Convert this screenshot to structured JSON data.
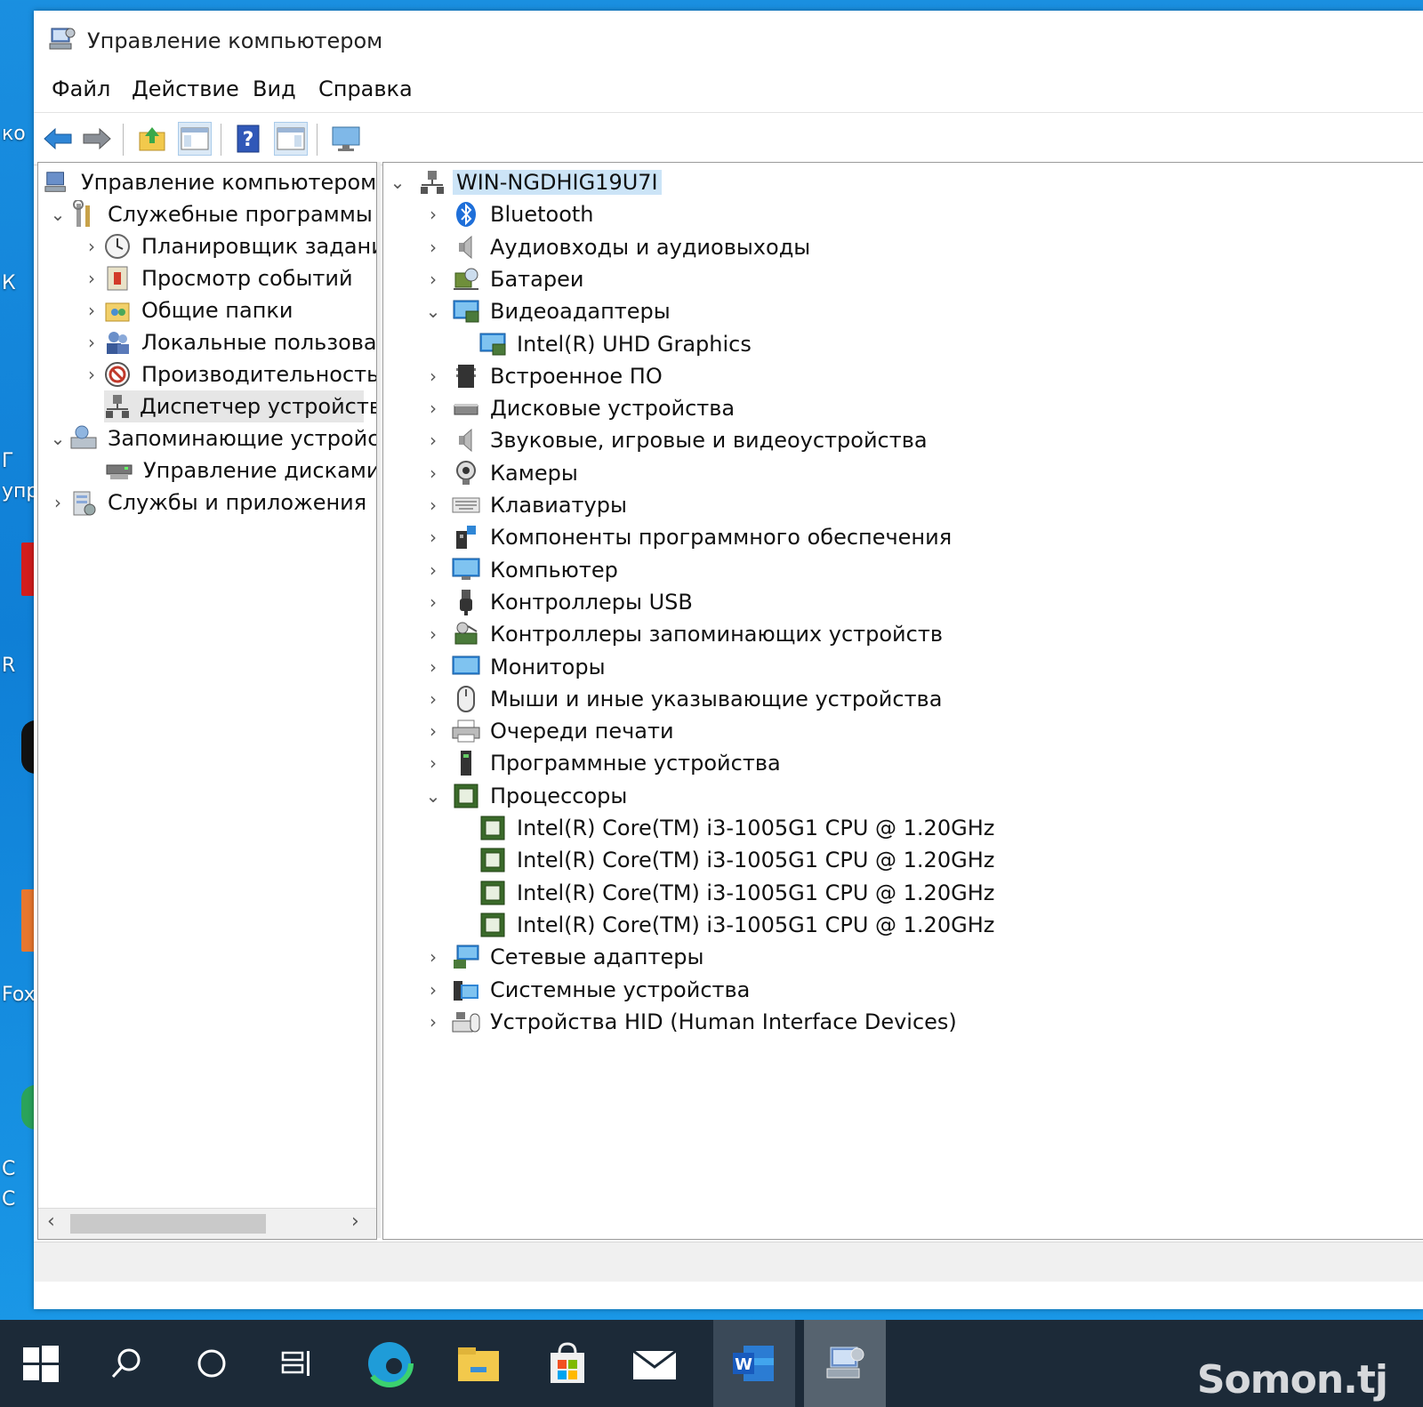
{
  "window": {
    "title": "Управление компьютером",
    "menu": [
      "Файл",
      "Действие",
      "Вид",
      "Справка"
    ]
  },
  "toolbar": {
    "buttons": [
      "back-arrow-icon",
      "forward-arrow-icon",
      "up-folder-icon",
      "show-hide-tree-icon",
      "help-icon",
      "action-pane-icon",
      "monitor-icon"
    ]
  },
  "left_tree": {
    "items": [
      {
        "label": "Управление компьютером (л",
        "icon": "computer-management-icon"
      },
      {
        "label": "Служебные программы",
        "icon": "tools-icon"
      },
      {
        "label": "Планировщик заданий",
        "icon": "clock-icon"
      },
      {
        "label": "Просмотр событий",
        "icon": "event-viewer-icon"
      },
      {
        "label": "Общие папки",
        "icon": "shared-folder-icon"
      },
      {
        "label": "Локальные пользовате",
        "icon": "users-icon"
      },
      {
        "label": "Производительность",
        "icon": "performance-icon"
      },
      {
        "label": "Диспетчер устройств",
        "icon": "device-manager-icon"
      },
      {
        "label": "Запоминающие устройст",
        "icon": "storage-icon"
      },
      {
        "label": "Управление дисками",
        "icon": "disk-management-icon"
      },
      {
        "label": "Службы и приложения",
        "icon": "services-icon"
      }
    ]
  },
  "device_tree": {
    "root": "WIN-NGDHIG19U7I",
    "items": [
      {
        "label": "Bluetooth",
        "icon": "bluetooth-icon"
      },
      {
        "label": "Аудиовходы и аудиовыходы",
        "icon": "speaker-icon"
      },
      {
        "label": "Батареи",
        "icon": "battery-icon"
      },
      {
        "label": "Видеоадаптеры",
        "icon": "display-adapter-icon"
      },
      {
        "label": "Intel(R) UHD Graphics",
        "icon": "display-adapter-icon"
      },
      {
        "label": "Встроенное ПО",
        "icon": "firmware-icon"
      },
      {
        "label": "Дисковые устройства",
        "icon": "disk-drive-icon"
      },
      {
        "label": "Звуковые, игровые и видеоустройства",
        "icon": "speaker-icon"
      },
      {
        "label": "Камеры",
        "icon": "camera-icon"
      },
      {
        "label": "Клавиатуры",
        "icon": "keyboard-icon"
      },
      {
        "label": "Компоненты программного обеспечения",
        "icon": "software-component-icon"
      },
      {
        "label": "Компьютер",
        "icon": "computer-icon"
      },
      {
        "label": "Контроллеры USB",
        "icon": "usb-icon"
      },
      {
        "label": "Контроллеры запоминающих устройств",
        "icon": "storage-controller-icon"
      },
      {
        "label": "Мониторы",
        "icon": "monitor-icon"
      },
      {
        "label": "Мыши и иные указывающие устройства",
        "icon": "mouse-icon"
      },
      {
        "label": "Очереди печати",
        "icon": "printer-icon"
      },
      {
        "label": "Программные устройства",
        "icon": "software-device-icon"
      },
      {
        "label": "Процессоры",
        "icon": "processor-icon"
      },
      {
        "label": "Intel(R) Core(TM) i3-1005G1 CPU @ 1.20GHz",
        "icon": "processor-icon"
      },
      {
        "label": "Intel(R) Core(TM) i3-1005G1 CPU @ 1.20GHz",
        "icon": "processor-icon"
      },
      {
        "label": "Intel(R) Core(TM) i3-1005G1 CPU @ 1.20GHz",
        "icon": "processor-icon"
      },
      {
        "label": "Intel(R) Core(TM) i3-1005G1 CPU @ 1.20GHz",
        "icon": "processor-icon"
      },
      {
        "label": "Сетевые адаптеры",
        "icon": "network-adapter-icon"
      },
      {
        "label": "Системные устройства",
        "icon": "system-device-icon"
      },
      {
        "label": "Устройства HID (Human Interface Devices)",
        "icon": "hid-icon"
      }
    ]
  },
  "desktop": {
    "labels": [
      "ко",
      "К",
      "Г",
      "упр",
      "R",
      "Fox",
      "С",
      "С"
    ]
  },
  "taskbar": {
    "items": [
      "start-icon",
      "search-icon",
      "cortana-icon",
      "task-view-icon",
      "edge-icon",
      "file-explorer-icon",
      "store-icon",
      "mail-icon",
      "word-icon",
      "computer-management-icon"
    ]
  },
  "watermark": "Somon.tj",
  "colors": {
    "selection": "#cce4f7",
    "taskbar": "#1c2a38",
    "desktop": "#1a8fe0"
  }
}
